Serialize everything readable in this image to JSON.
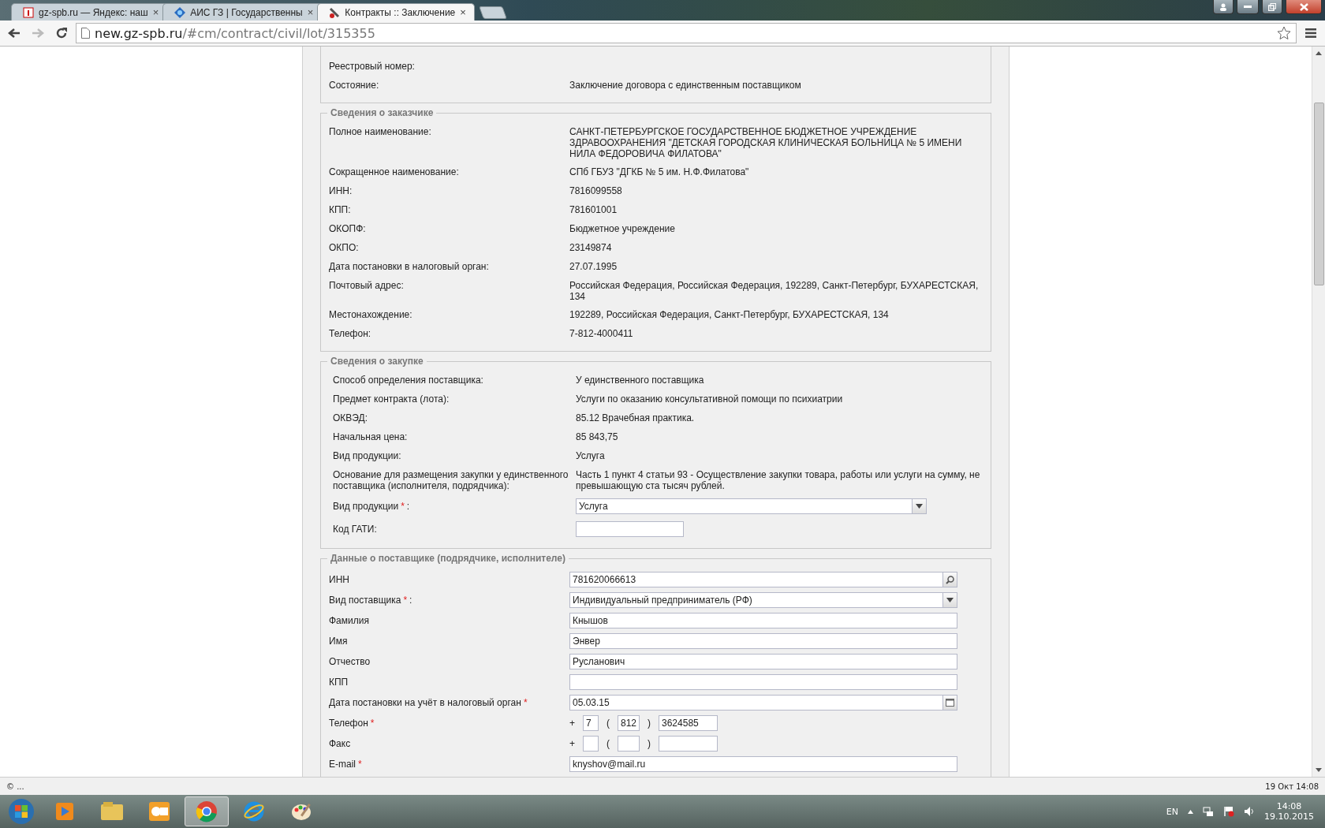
{
  "browser": {
    "tabs": [
      {
        "title": "gz-spb.ru — Яндекс: наш",
        "kind": "yandex",
        "selected": false
      },
      {
        "title": "АИС ГЗ | Государственны",
        "kind": "ais",
        "selected": false
      },
      {
        "title": "Контракты :: Заключение",
        "kind": "tools",
        "selected": true
      }
    ],
    "close_glyph": "×",
    "url": {
      "host": "new.gz-spb.ru",
      "path": "/#cm/contract/civil/lot/315355"
    }
  },
  "record_section": {
    "rows": [
      {
        "label": "Реестровый номер:"
      },
      {
        "label": "Состояние:",
        "value": "Заключение договора с единственным поставщиком"
      }
    ]
  },
  "customer_section": {
    "legend": "Сведения о заказчике",
    "rows": [
      {
        "label": "Полное наименование:",
        "value": "САНКТ-ПЕТЕРБУРГСКОЕ ГОСУДАРСТВЕННОЕ БЮДЖЕТНОЕ УЧРЕЖДЕНИЕ ЗДРАВООХРАНЕНИЯ \"ДЕТСКАЯ ГОРОДСКАЯ КЛИНИЧЕСКАЯ БОЛЬНИЦА № 5 ИМЕНИ НИЛА ФЕДОРОВИЧА ФИЛАТОВА\""
      },
      {
        "label": "Сокращенное наименование:",
        "value": "СПб ГБУЗ \"ДГКБ № 5 им. Н.Ф.Филатова\""
      },
      {
        "label": "ИНН:",
        "value": "7816099558"
      },
      {
        "label": "КПП:",
        "value": "781601001"
      },
      {
        "label": "ОКОПФ:",
        "value": "Бюджетное учреждение"
      },
      {
        "label": "ОКПО:",
        "value": "23149874"
      },
      {
        "label": "Дата постановки в налоговый орган:",
        "value": "27.07.1995"
      },
      {
        "label": "Почтовый адрес:",
        "value": "Российская Федерация, Российская Федерация, 192289, Санкт-Петербург, БУХАРЕСТСКАЯ, 134"
      },
      {
        "label": "Местонахождение:",
        "value": "192289, Российская Федерация, Санкт-Петербург, БУХАРЕСТСКАЯ, 134"
      },
      {
        "label": "Телефон:",
        "value": "7-812-4000411"
      }
    ]
  },
  "purchase_section": {
    "legend": "Сведения о закупке",
    "rows": [
      {
        "label": "Способ определения поставщика:",
        "value": "У единственного поставщика"
      },
      {
        "label": "Предмет контракта (лота):",
        "value": "Услуги по оказанию консультативной помощи по психиатрии"
      },
      {
        "label": "ОКВЭД:",
        "value": "85.12 Врачебная практика."
      },
      {
        "label": "Начальная цена:",
        "value": "85 843,75"
      },
      {
        "label": "Вид продукции:",
        "value": "Услуга"
      },
      {
        "label": "Основание для размещения закупки у единственного поставщика (исполнителя, подрядчика):",
        "value": "Часть 1 пункт 4 статьи 93 - Осуществление закупки товара, работы или услуги на сумму, не превышающую ста тысяч рублей."
      }
    ],
    "fields": [
      {
        "kind": "select",
        "label": "Вид продукции",
        "mark": "*",
        "after": ":",
        "value": "Услуга"
      },
      {
        "kind": "short",
        "label": "Код ГАТИ:"
      }
    ]
  },
  "supplier_section": {
    "legend": "Данные о поставщике (подрядчике, исполнителе)",
    "fields": [
      {
        "kind": "search",
        "label": "ИНН",
        "value": "781620066613"
      },
      {
        "kind": "select",
        "label": "Вид поставщика",
        "mark": "*",
        "after": ":",
        "value": "Индивидуальный предприниматель (РФ)"
      },
      {
        "kind": "text",
        "label": "Фамилия",
        "value": "Кнышов"
      },
      {
        "kind": "text",
        "label": "Имя",
        "value": "Энвер"
      },
      {
        "kind": "text",
        "label": "Отчество",
        "value": "Русланович"
      },
      {
        "kind": "text",
        "label": "КПП"
      },
      {
        "kind": "date",
        "label": "Дата постановки на учёт в налоговый орган",
        "mark": "*",
        "value": "05.03.15"
      },
      {
        "kind": "phone",
        "label": "Телефон",
        "mark": "*",
        "plus": "+",
        "open": "(",
        "close": ")",
        "country": "7",
        "area": "812",
        "number": "3624585"
      },
      {
        "kind": "phone",
        "label": "Факс",
        "plus": "+",
        "open": "(",
        "close": ")"
      },
      {
        "kind": "text",
        "label": "E-mail",
        "mark": "*",
        "value": "knyshov@mail.ru"
      }
    ]
  },
  "status_bar": {
    "left": "© ...",
    "right": "19 Окт 14:08"
  },
  "taskbar": {
    "apps": [
      {
        "kind": "player",
        "selected": false
      },
      {
        "kind": "folder",
        "selected": false
      },
      {
        "kind": "mail",
        "selected": false
      },
      {
        "kind": "chrome",
        "selected": true
      },
      {
        "kind": "ie",
        "selected": false
      },
      {
        "kind": "paint",
        "selected": false
      }
    ],
    "language": "EN",
    "time": "14:08",
    "date": "19.10.2015"
  }
}
